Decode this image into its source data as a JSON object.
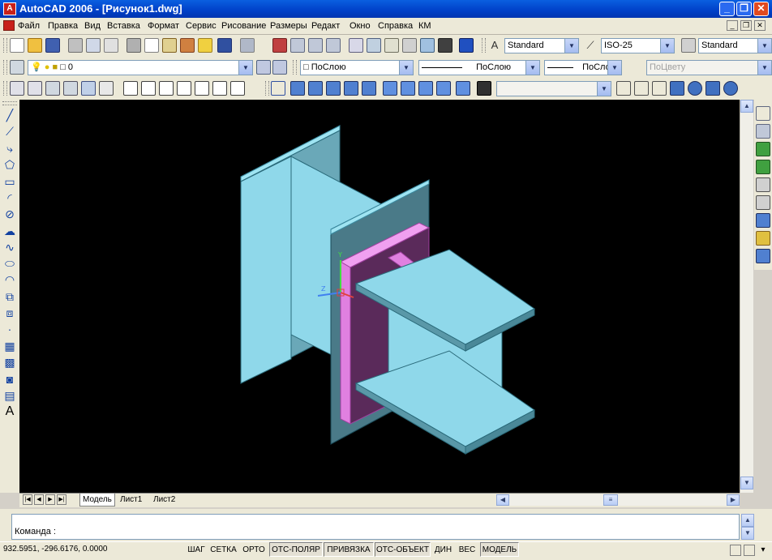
{
  "window": {
    "title": "AutoCAD 2006 - [Рисунок1.dwg]",
    "min": "_",
    "max": "❐",
    "close": "✕"
  },
  "menu": [
    "Файл",
    "Правка",
    "Вид",
    "Вставка",
    "Формат",
    "Сервис",
    "Рисование",
    "Размеры",
    "Редакт",
    "Окно",
    "Справка",
    "КМ"
  ],
  "styles": {
    "text_style": "Standard",
    "dim_style": "ISO-25",
    "table_style": "Standard"
  },
  "layers": {
    "current_layer": "0",
    "color": "ПоСлою",
    "linetype": "ПоСлою",
    "lineweight": "ПоСлою",
    "plot_style": "ПоЦвету"
  },
  "tabs": [
    "Модель",
    "Лист1",
    "Лист2"
  ],
  "command": {
    "prompt": "Команда :"
  },
  "status": {
    "coordinates": "932.5951, -296.6176, 0.0000",
    "toggles": [
      "ШАГ",
      "СЕТКА",
      "ОРТО",
      "ОТС-ПОЛЯР",
      "ПРИВЯЗКА",
      "ОТС-ОБЪЕКТ",
      "ДИН",
      "ВЕС",
      "МОДЕЛЬ"
    ]
  },
  "colors": {
    "beam": "#8fd8ea",
    "plate": "#e080e0",
    "background": "#000000"
  }
}
